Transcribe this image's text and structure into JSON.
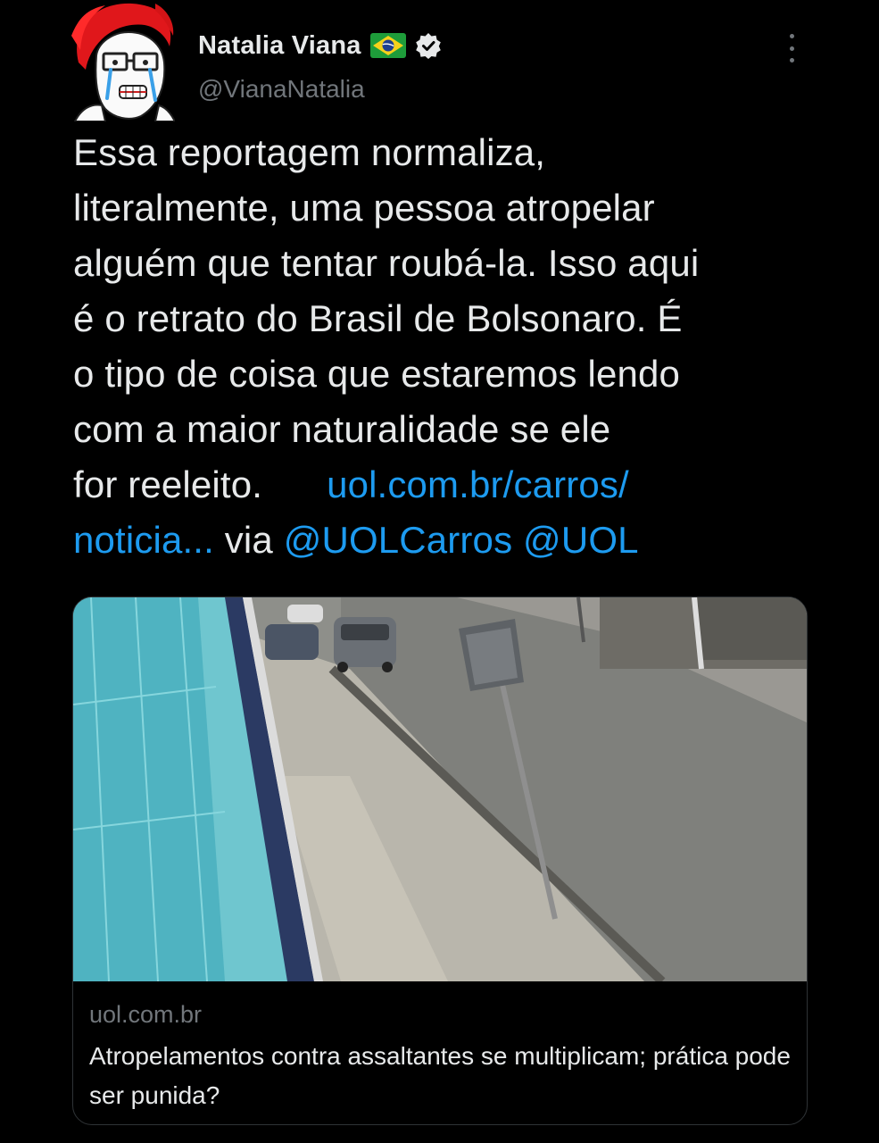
{
  "author": {
    "display_name": "Natalia Viana",
    "handle": "@VianaNatalia",
    "flag_icon": "brazil-flag-icon",
    "verified_icon": "verified-badge-icon"
  },
  "tweet": {
    "line1": "Essa reportagem normaliza,",
    "line2": "literalmente, uma pessoa atropelar",
    "line3": "alguém que tentar roubá-la. Isso aqui",
    "line4": "é o retrato do Brasil de Bolsonaro. É",
    "line5": "o tipo de coisa que estaremos lendo",
    "line6": "com a maior naturalidade se ele",
    "line7_text": "for reeleito.",
    "link_part1": "uol.com.br/carros/",
    "link_part2": "noticia...",
    "via_text": " via ",
    "mention1": "@UOLCarros",
    "mention2": "@UOL"
  },
  "card": {
    "domain": "uol.com.br",
    "title": "Atropelamentos contra assaltantes se multiplicam; prática pode ser punida?",
    "image_description_icon": "street-cctv-photo"
  },
  "colors": {
    "background": "#000000",
    "text": "#e7e9ea",
    "secondary": "#71767b",
    "link": "#1d9bf0",
    "border": "#2f3336"
  }
}
